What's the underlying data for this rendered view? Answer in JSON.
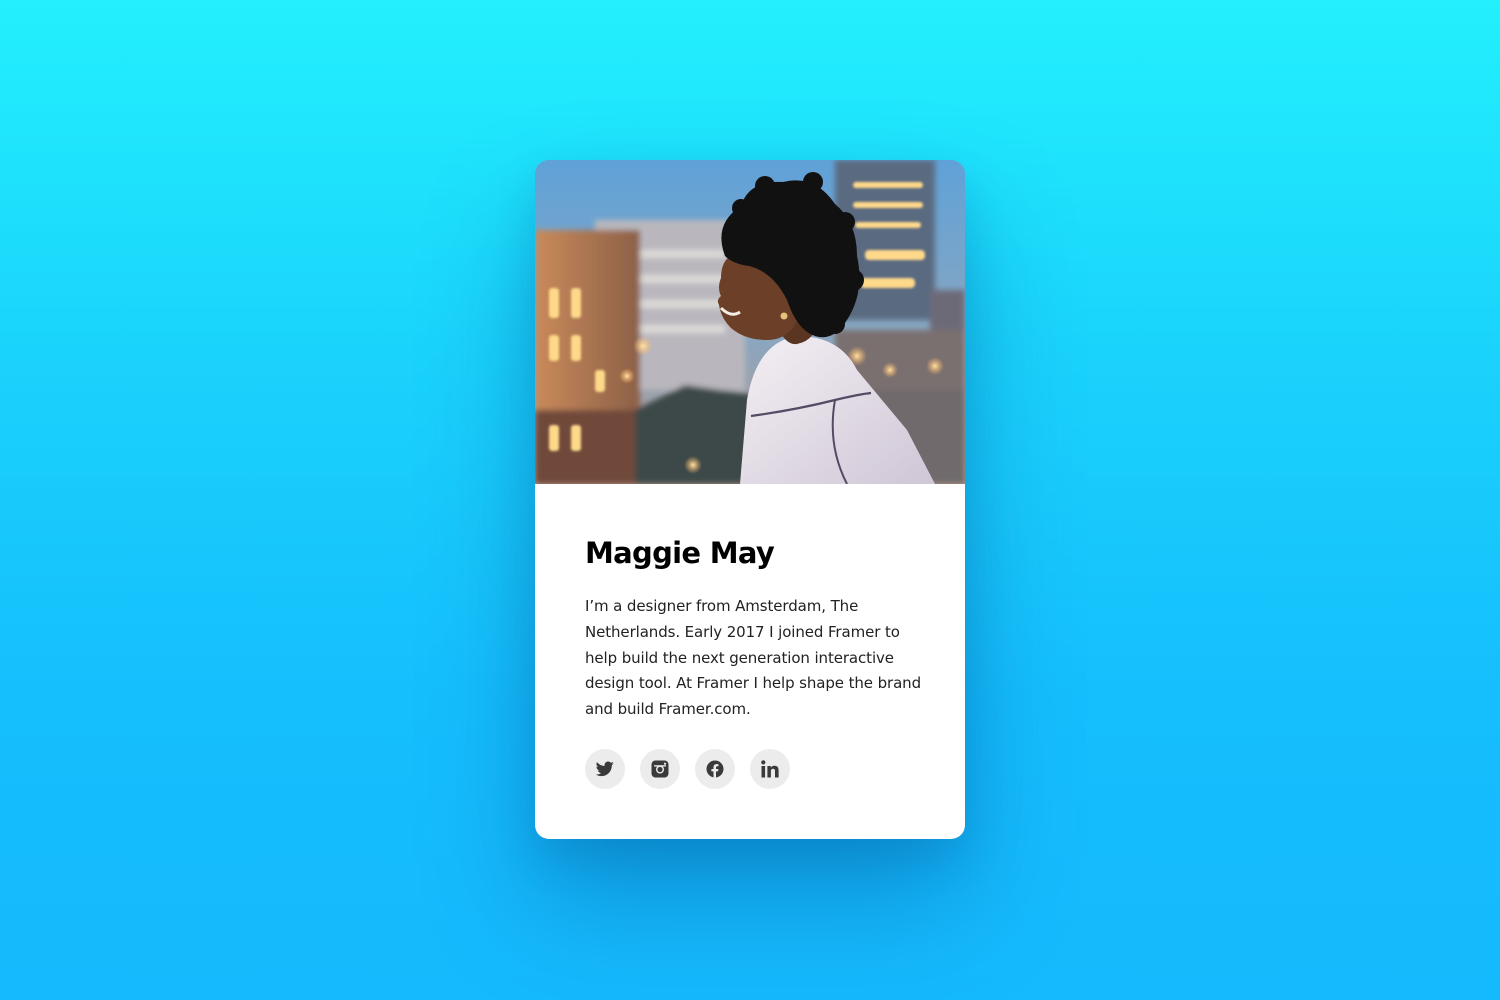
{
  "profile": {
    "name": "Maggie May",
    "bio": "I’m a designer from Amsterdam, The Netherlands. Early 2017 I joined Framer to help build the next generation interactive design tool. At Framer I help shape the brand and build Framer.com."
  },
  "socials": [
    {
      "icon": "twitter-icon"
    },
    {
      "icon": "instagram-icon"
    },
    {
      "icon": "facebook-icon"
    },
    {
      "icon": "linkedin-icon"
    }
  ],
  "colors": {
    "background_top": "#22f0fd",
    "background_bottom": "#15b9fd",
    "card": "#ffffff",
    "social_button": "#ececec",
    "icon": "#3a3a3a"
  }
}
